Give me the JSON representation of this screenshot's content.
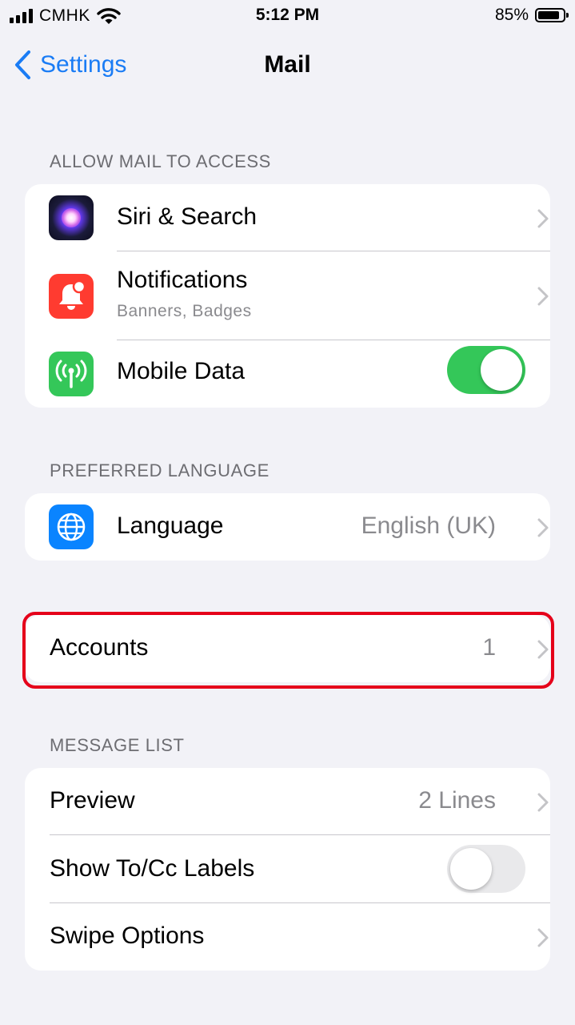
{
  "status_bar": {
    "carrier": "CMHK",
    "time": "5:12 PM",
    "battery_percent": "85%",
    "battery_level": 0.85
  },
  "nav": {
    "back_label": "Settings",
    "title": "Mail"
  },
  "sections": {
    "allow_access": {
      "header": "ALLOW MAIL TO ACCESS",
      "rows": [
        {
          "title": "Siri & Search",
          "icon": "siri-icon"
        },
        {
          "title": "Notifications",
          "subtitle": "Banners, Badges",
          "icon": "notifications-icon"
        },
        {
          "title": "Mobile Data",
          "icon": "antenna-icon",
          "toggle_on": true
        }
      ]
    },
    "language": {
      "header": "PREFERRED LANGUAGE",
      "rows": [
        {
          "title": "Language",
          "value": "English (UK)",
          "icon": "globe-icon"
        }
      ]
    },
    "accounts": {
      "rows": [
        {
          "title": "Accounts",
          "value": "1"
        }
      ]
    },
    "message_list": {
      "header": "MESSAGE LIST",
      "rows": [
        {
          "title": "Preview",
          "value": "2 Lines"
        },
        {
          "title": "Show To/Cc Labels",
          "toggle_on": false
        },
        {
          "title": "Swipe Options"
        }
      ]
    }
  },
  "colors": {
    "accent_blue": "#1a7cf5",
    "toggle_on": "#34c759",
    "toggle_off": "#e9e9eb",
    "highlight_red": "#e5001a",
    "notifications_red": "#ff3b30",
    "mobile_data_green": "#34c759",
    "globe_blue": "#0a84ff"
  }
}
